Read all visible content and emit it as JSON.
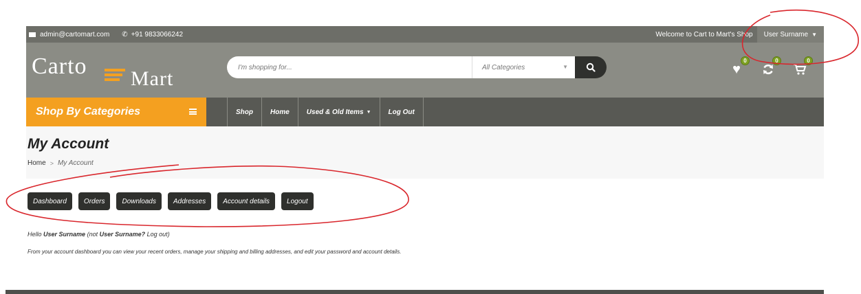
{
  "topbar": {
    "email": "admin@cartomart.com",
    "phone": "+91 9833066242",
    "welcome": "Welcome to Cart to Mart's Shop",
    "user_name": "User Surname"
  },
  "header": {
    "logo_line1": "Carto",
    "logo_line2": "Mart",
    "search_placeholder": "I'm shopping for...",
    "category_select": "All Categories",
    "wishlist_count": "0",
    "compare_count": "0",
    "cart_count": "0"
  },
  "nav": {
    "shop_by_categories": "Shop By Categories",
    "links": [
      {
        "label": "Shop"
      },
      {
        "label": "Home"
      },
      {
        "label": "Used & Old Items"
      },
      {
        "label": "Log Out"
      }
    ]
  },
  "page": {
    "title": "My Account",
    "breadcrumb_home": "Home",
    "breadcrumb_sep": ">",
    "breadcrumb_current": "My Account"
  },
  "account_tabs": [
    {
      "label": "Dashboard"
    },
    {
      "label": "Orders"
    },
    {
      "label": "Downloads"
    },
    {
      "label": "Addresses"
    },
    {
      "label": "Account details"
    },
    {
      "label": "Logout"
    }
  ],
  "greeting": {
    "hello": "Hello",
    "user": "User Surname",
    "not_prefix": "(not",
    "user_again": "User Surname?",
    "logout_link": "Log out",
    "close_paren": ")"
  },
  "description": "From your account dashboard you can view your recent orders, manage your shipping and billing addresses, and edit your password and account details.",
  "colors": {
    "topbar": "#6d6e68",
    "header": "#8b8c85",
    "nav": "#585954",
    "accent": "#f4a020",
    "badge": "#7ea123",
    "annotation": "#d9262c"
  }
}
